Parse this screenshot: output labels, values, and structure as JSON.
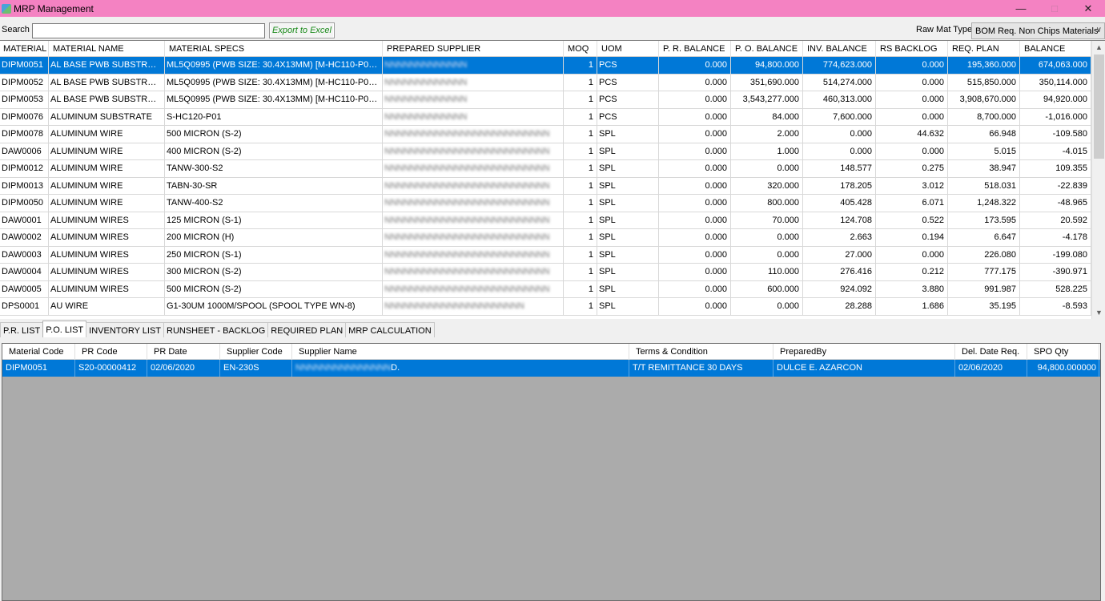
{
  "window": {
    "title": "MRP Management"
  },
  "toolbar": {
    "search_label": "Search :",
    "search_value": "",
    "export_label": "Export to Excel",
    "rawmat_label": "Raw Mat Type:",
    "rawmat_value": "BOM Req. Non Chips Materials"
  },
  "main_grid": {
    "columns": [
      "MATERIAL",
      "MATERIAL NAME",
      "MATERIAL SPECS",
      "PREPARED SUPPLIER",
      "MOQ",
      "UOM",
      "P. R. BALANCE",
      "P. O. BALANCE",
      "INV. BALANCE",
      "RS BACKLOG",
      "REQ. PLAN",
      "BALANCE"
    ],
    "rows": [
      [
        "DIPM0051",
        "AL BASE PWB SUBSTRATE",
        "ML5Q0995 (PWB SIZE: 30.4X13MM) [M-HC110-P02] [MO...",
        "",
        "1",
        "PCS",
        "0.000",
        "94,800.000",
        "774,623.000",
        "0.000",
        "195,360.000",
        "674,063.000"
      ],
      [
        "DIPM0052",
        "AL BASE PWB SUBSTRATE",
        "ML5Q0995 (PWB SIZE: 30.4X13MM) [M-HC110-P01] [MO...",
        "",
        "1",
        "PCS",
        "0.000",
        "351,690.000",
        "514,274.000",
        "0.000",
        "515,850.000",
        "350,114.000"
      ],
      [
        "DIPM0053",
        "AL BASE PWB SUBSTRATE",
        "ML5Q0995 (PWB SIZE: 30.4X13MM) [M-HC110-P03] [MO...",
        "",
        "1",
        "PCS",
        "0.000",
        "3,543,277.000",
        "460,313.000",
        "0.000",
        "3,908,670.000",
        "94,920.000"
      ],
      [
        "DIPM0076",
        "ALUMINUM SUBSTRATE",
        "S-HC120-P01",
        "",
        "1",
        "PCS",
        "0.000",
        "84.000",
        "7,600.000",
        "0.000",
        "8,700.000",
        "-1,016.000"
      ],
      [
        "DIPM0078",
        "ALUMINUM WIRE",
        "500 MICRON (S-2)",
        "",
        "1",
        "SPL",
        "0.000",
        "2.000",
        "0.000",
        "44.632",
        "66.948",
        "-109.580"
      ],
      [
        "DAW0006",
        "ALUMINUM WIRE",
        "400 MICRON (S-2)",
        "",
        "1",
        "SPL",
        "0.000",
        "1.000",
        "0.000",
        "0.000",
        "5.015",
        "-4.015"
      ],
      [
        "DIPM0012",
        "ALUMINUM WIRE",
        "TANW-300-S2",
        "",
        "1",
        "SPL",
        "0.000",
        "0.000",
        "148.577",
        "0.275",
        "38.947",
        "109.355"
      ],
      [
        "DIPM0013",
        "ALUMINUM WIRE",
        "TABN-30-SR",
        "",
        "1",
        "SPL",
        "0.000",
        "320.000",
        "178.205",
        "3.012",
        "518.031",
        "-22.839"
      ],
      [
        "DIPM0050",
        "ALUMINUM WIRE",
        "TANW-400-S2",
        "",
        "1",
        "SPL",
        "0.000",
        "800.000",
        "405.428",
        "6.071",
        "1,248.322",
        "-48.965"
      ],
      [
        "DAW0001",
        "ALUMINUM WIRES",
        "125 MICRON (S-1)",
        "",
        "1",
        "SPL",
        "0.000",
        "70.000",
        "124.708",
        "0.522",
        "173.595",
        "20.592"
      ],
      [
        "DAW0002",
        "ALUMINUM WIRES",
        "200 MICRON (H)",
        "",
        "1",
        "SPL",
        "0.000",
        "0.000",
        "2.663",
        "0.194",
        "6.647",
        "-4.178"
      ],
      [
        "DAW0003",
        "ALUMINUM WIRES",
        "250 MICRON (S-1)",
        "",
        "1",
        "SPL",
        "0.000",
        "0.000",
        "27.000",
        "0.000",
        "226.080",
        "-199.080"
      ],
      [
        "DAW0004",
        "ALUMINUM WIRES",
        "300 MICRON (S-2)",
        "",
        "1",
        "SPL",
        "0.000",
        "110.000",
        "276.416",
        "0.212",
        "777.175",
        "-390.971"
      ],
      [
        "DAW0005",
        "ALUMINUM WIRES",
        "500 MICRON (S-2)",
        "",
        "1",
        "SPL",
        "0.000",
        "600.000",
        "924.092",
        "3.880",
        "991.987",
        "528.225"
      ],
      [
        "DPS0001",
        "AU WIRE",
        "G1-30UM 1000M/SPOOL (SPOOL TYPE WN-8)",
        "",
        "1",
        "SPL",
        "0.000",
        "0.000",
        "28.288",
        "1.686",
        "35.195",
        "-8.593"
      ]
    ]
  },
  "tabs": [
    "P.R. LIST",
    "P.O. LIST",
    "INVENTORY LIST",
    "RUNSHEET - BACKLOG",
    "REQUIRED PLAN",
    "MRP CALCULATION"
  ],
  "active_tab": "P.O. LIST",
  "po_grid": {
    "columns": [
      "Material Code",
      "PR Code",
      "PR Date",
      "Supplier Code",
      "Supplier Name",
      "Terms & Condition",
      "PreparedBy",
      "Del. Date Req.",
      "SPO Qty"
    ],
    "rows": [
      [
        "DIPM0051",
        "S20-00000412",
        "02/06/2020",
        "EN-230S",
        "D.",
        "T/T REMITTANCE 30 DAYS",
        "DULCE E. AZARCON",
        "02/06/2020",
        "94,800.000000"
      ]
    ]
  },
  "colors": {
    "titlebar": "#f482c2",
    "selection": "#0078d7",
    "export_text": "#1a8a1a",
    "empty_grid_bg": "#ababab"
  }
}
